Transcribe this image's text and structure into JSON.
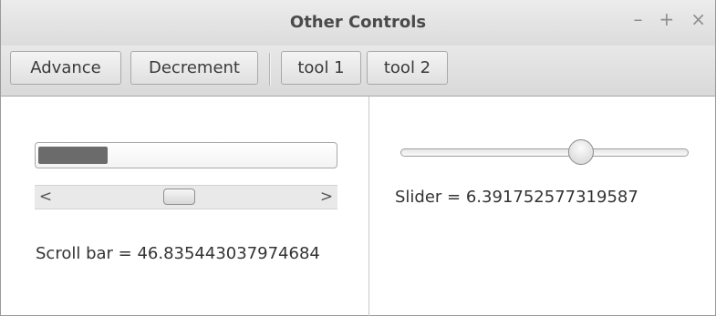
{
  "window": {
    "title": "Other Controls",
    "controls": {
      "minimize": "–",
      "maximize": "+",
      "close": "×"
    }
  },
  "toolbar": {
    "advance_label": "Advance",
    "decrement_label": "Decrement",
    "tool1_label": "tool 1",
    "tool2_label": "tool 2"
  },
  "left_pane": {
    "progress_fraction": 0.235,
    "scrollbar": {
      "value": 46.835443037974684,
      "left_arrow": "<",
      "right_arrow": ">"
    },
    "scroll_label": "Scroll bar = 46.835443037974684"
  },
  "right_pane": {
    "slider_value": 6.391752577319587,
    "slider_label": "Slider = 6.391752577319587"
  }
}
